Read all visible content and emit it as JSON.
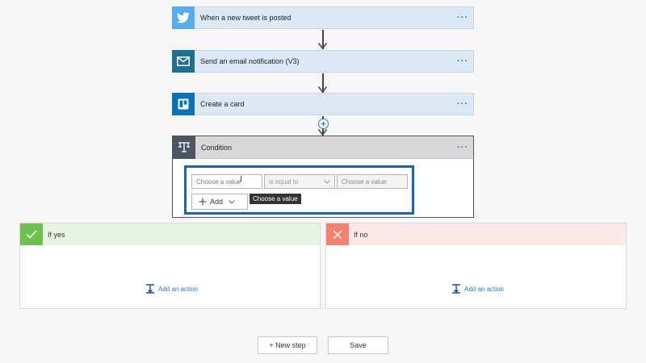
{
  "steps": [
    {
      "title": "When a new tweet is posted",
      "icon": "twitter-icon",
      "color": "#55acee"
    },
    {
      "title": "Send an email notification (V3)",
      "icon": "mail-icon",
      "color": "#1f6e93"
    },
    {
      "title": "Create a card",
      "icon": "trello-icon",
      "color": "#0a72ba"
    }
  ],
  "more_label": "···",
  "condition": {
    "title": "Condition",
    "icon": "condition-icon",
    "left_placeholder": "Choose a value",
    "operator": "is equal to",
    "right_placeholder": "Choose a value",
    "tooltip": "Choose a value",
    "add_label": "Add"
  },
  "branches": {
    "yes": {
      "label": "If yes",
      "color": "#e7f4e3",
      "icon_color": "#6cc24a",
      "action": "Add an action"
    },
    "no": {
      "label": "If no",
      "color": "#fce8e6",
      "icon_color": "#f48170",
      "action": "Add an action"
    }
  },
  "footer": {
    "new_step": "+ New step",
    "save": "Save"
  }
}
